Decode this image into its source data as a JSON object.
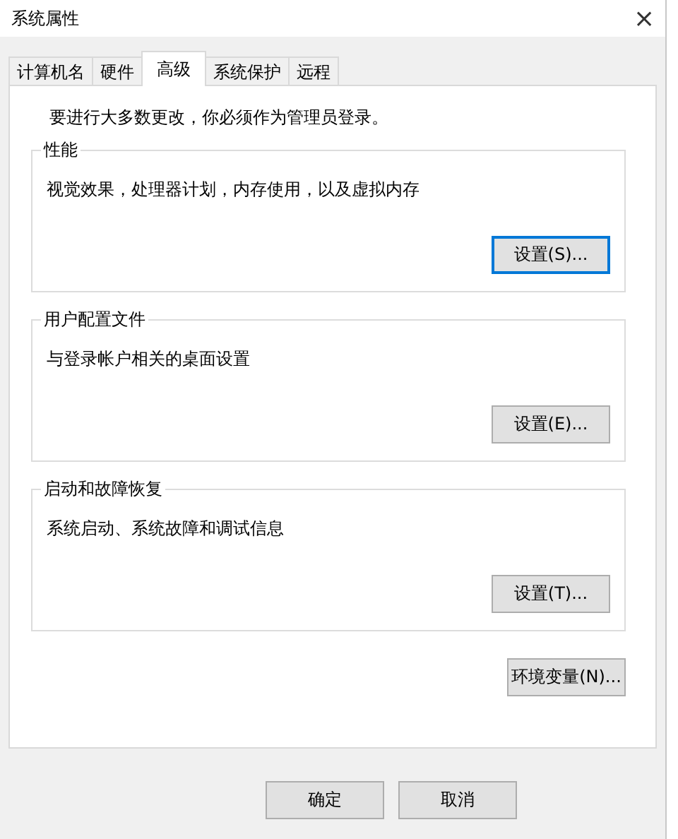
{
  "window": {
    "title": "系统属性",
    "close": "×"
  },
  "tabs": [
    {
      "label": "计算机名",
      "selected": false
    },
    {
      "label": "硬件",
      "selected": false
    },
    {
      "label": "高级",
      "selected": true
    },
    {
      "label": "系统保护",
      "selected": false
    },
    {
      "label": "远程",
      "selected": false
    }
  ],
  "notice": "要进行大多数更改，你必须作为管理员登录。",
  "groups": [
    {
      "title": "性能",
      "description": "视觉效果，处理器计划，内存使用，以及虚拟内存",
      "button": {
        "label": "设置(S)...",
        "focused": true
      }
    },
    {
      "title": "用户配置文件",
      "description": "与登录帐户相关的桌面设置",
      "button": {
        "label": "设置(E)...",
        "focused": false
      }
    },
    {
      "title": "启动和故障恢复",
      "description": "系统启动、系统故障和调试信息",
      "button": {
        "label": "设置(T)...",
        "focused": false
      }
    }
  ],
  "env_button": "环境变量(N)...",
  "buttons": [
    "确定",
    "取消"
  ]
}
